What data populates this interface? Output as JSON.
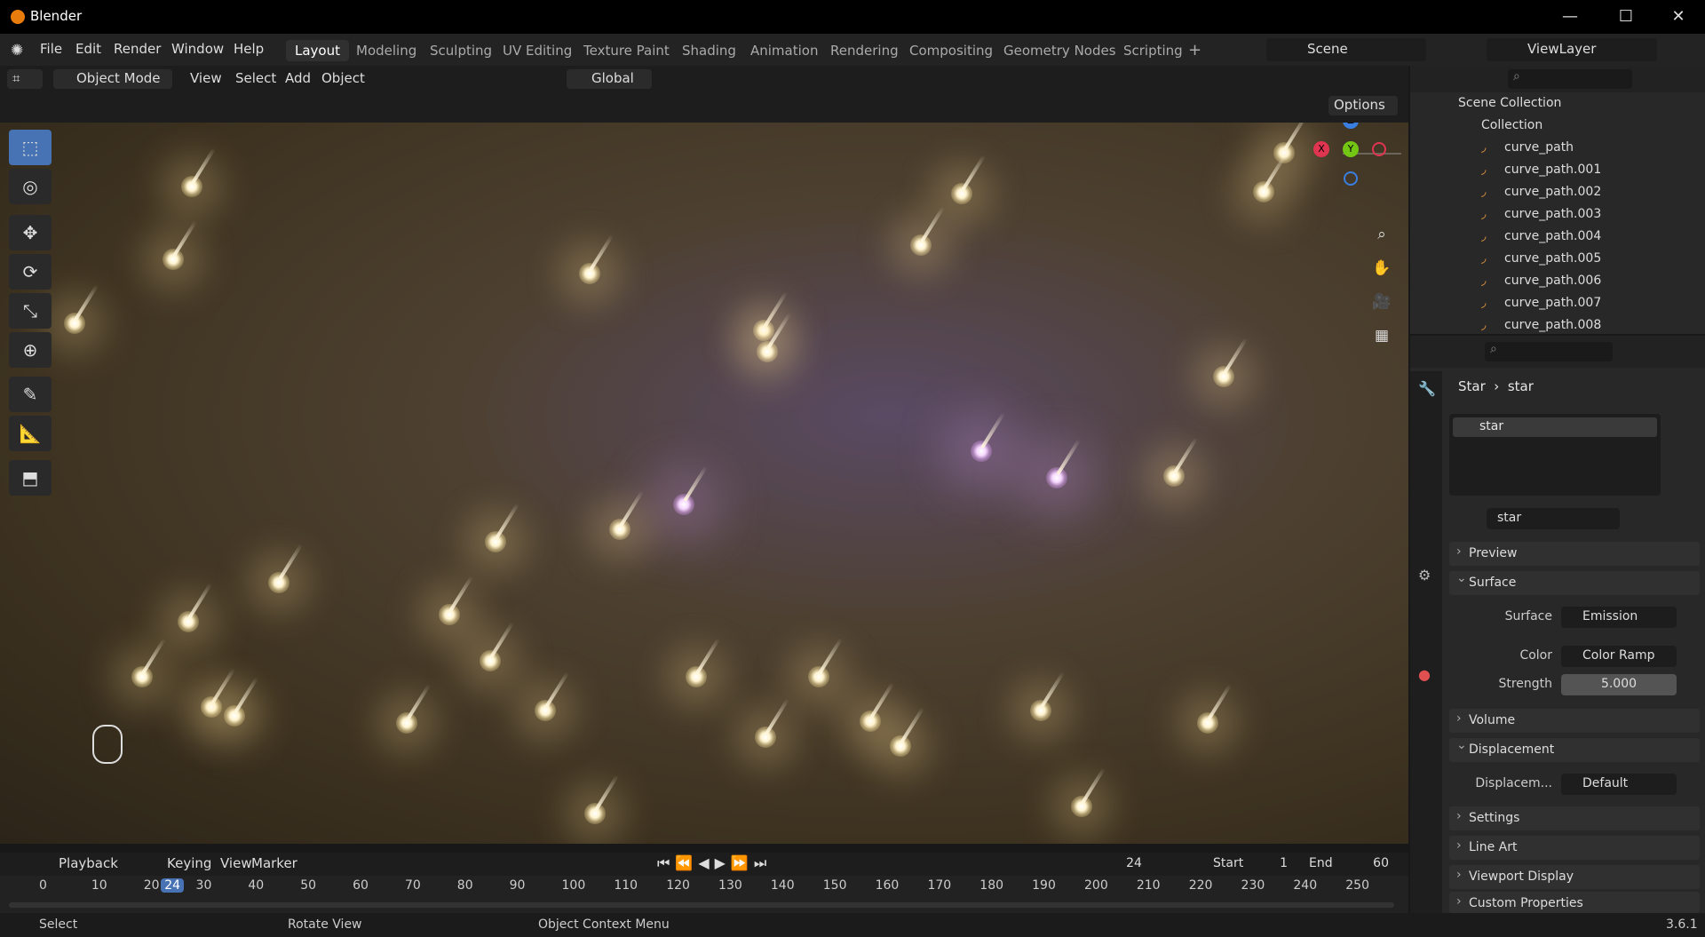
{
  "app": {
    "title": "Blender",
    "version": "3.6.1"
  },
  "menus": [
    "File",
    "Edit",
    "Render",
    "Window",
    "Help"
  ],
  "workspaces": [
    "Layout",
    "Modeling",
    "Sculpting",
    "UV Editing",
    "Texture Paint",
    "Shading",
    "Animation",
    "Rendering",
    "Compositing",
    "Geometry Nodes",
    "Scripting"
  ],
  "active_workspace": "Layout",
  "scene": "Scene",
  "view_layer": "ViewLayer",
  "viewport": {
    "mode": "Object Mode",
    "menus": [
      "View",
      "Select",
      "Add",
      "Object"
    ],
    "transform": "Global",
    "options": "Options"
  },
  "outliner": {
    "root": "Scene Collection",
    "collection": "Collection",
    "items": [
      "curve_path",
      "curve_path.001",
      "curve_path.002",
      "curve_path.003",
      "curve_path.004",
      "curve_path.005",
      "curve_path.006",
      "curve_path.007",
      "curve_path.008"
    ]
  },
  "properties": {
    "object": "Star",
    "material": "star",
    "slot": "star",
    "datablock": "star",
    "panels": {
      "preview": "Preview",
      "surface": "Surface",
      "volume": "Volume",
      "displacement": "Displacement",
      "settings": "Settings",
      "lineart": "Line Art",
      "viewport_display": "Viewport Display",
      "custom": "Custom Properties"
    },
    "surface_label": "Surface",
    "surface_value": "Emission",
    "color_label": "Color",
    "color_value": "Color Ramp",
    "strength_label": "Strength",
    "strength_value": "5.000",
    "displacement_label": "Displacem...",
    "displacement_value": "Default"
  },
  "timeline": {
    "menus": [
      "Playback",
      "Keying",
      "View",
      "Marker"
    ],
    "current_frame": "24",
    "start_label": "Start",
    "start": "1",
    "end_label": "End",
    "end": "60",
    "ticks": [
      "0",
      "10",
      "20",
      "24",
      "30",
      "40",
      "50",
      "60",
      "70",
      "80",
      "90",
      "100",
      "110",
      "120",
      "130",
      "140",
      "150",
      "160",
      "170",
      "180",
      "190",
      "200",
      "210",
      "220",
      "230",
      "240",
      "250"
    ]
  },
  "status": {
    "select": "Select",
    "rotate": "Rotate View",
    "context": "Object Context Menu"
  }
}
